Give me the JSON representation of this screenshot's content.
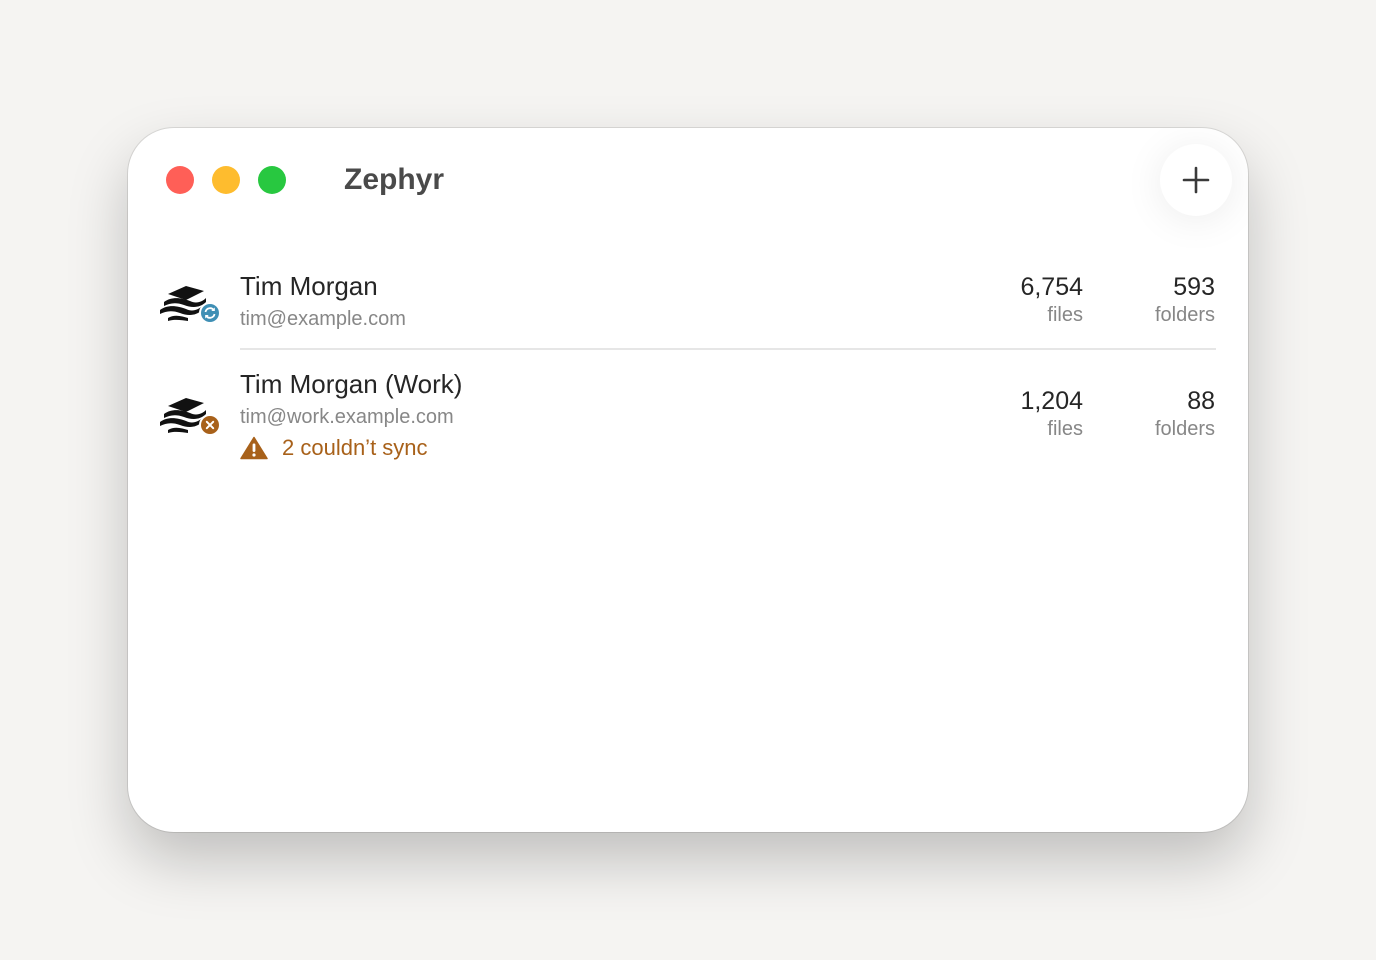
{
  "window": {
    "title": "Zephyr"
  },
  "toolbar": {
    "add_icon": "plus-icon"
  },
  "accounts": [
    {
      "name": "Tim Morgan",
      "email": "tim@example.com",
      "status": "syncing",
      "status_icon": "sync-badge-icon",
      "status_color": "#3f8fb5",
      "files_count": "6,754",
      "files_label": "files",
      "folders_count": "593",
      "folders_label": "folders"
    },
    {
      "name": "Tim Morgan (Work)",
      "email": "tim@work.example.com",
      "status": "error",
      "status_icon": "error-badge-icon",
      "status_color": "#a8611a",
      "warning": "2 couldn’t sync",
      "files_count": "1,204",
      "files_label": "files",
      "folders_count": "88",
      "folders_label": "folders"
    }
  ]
}
